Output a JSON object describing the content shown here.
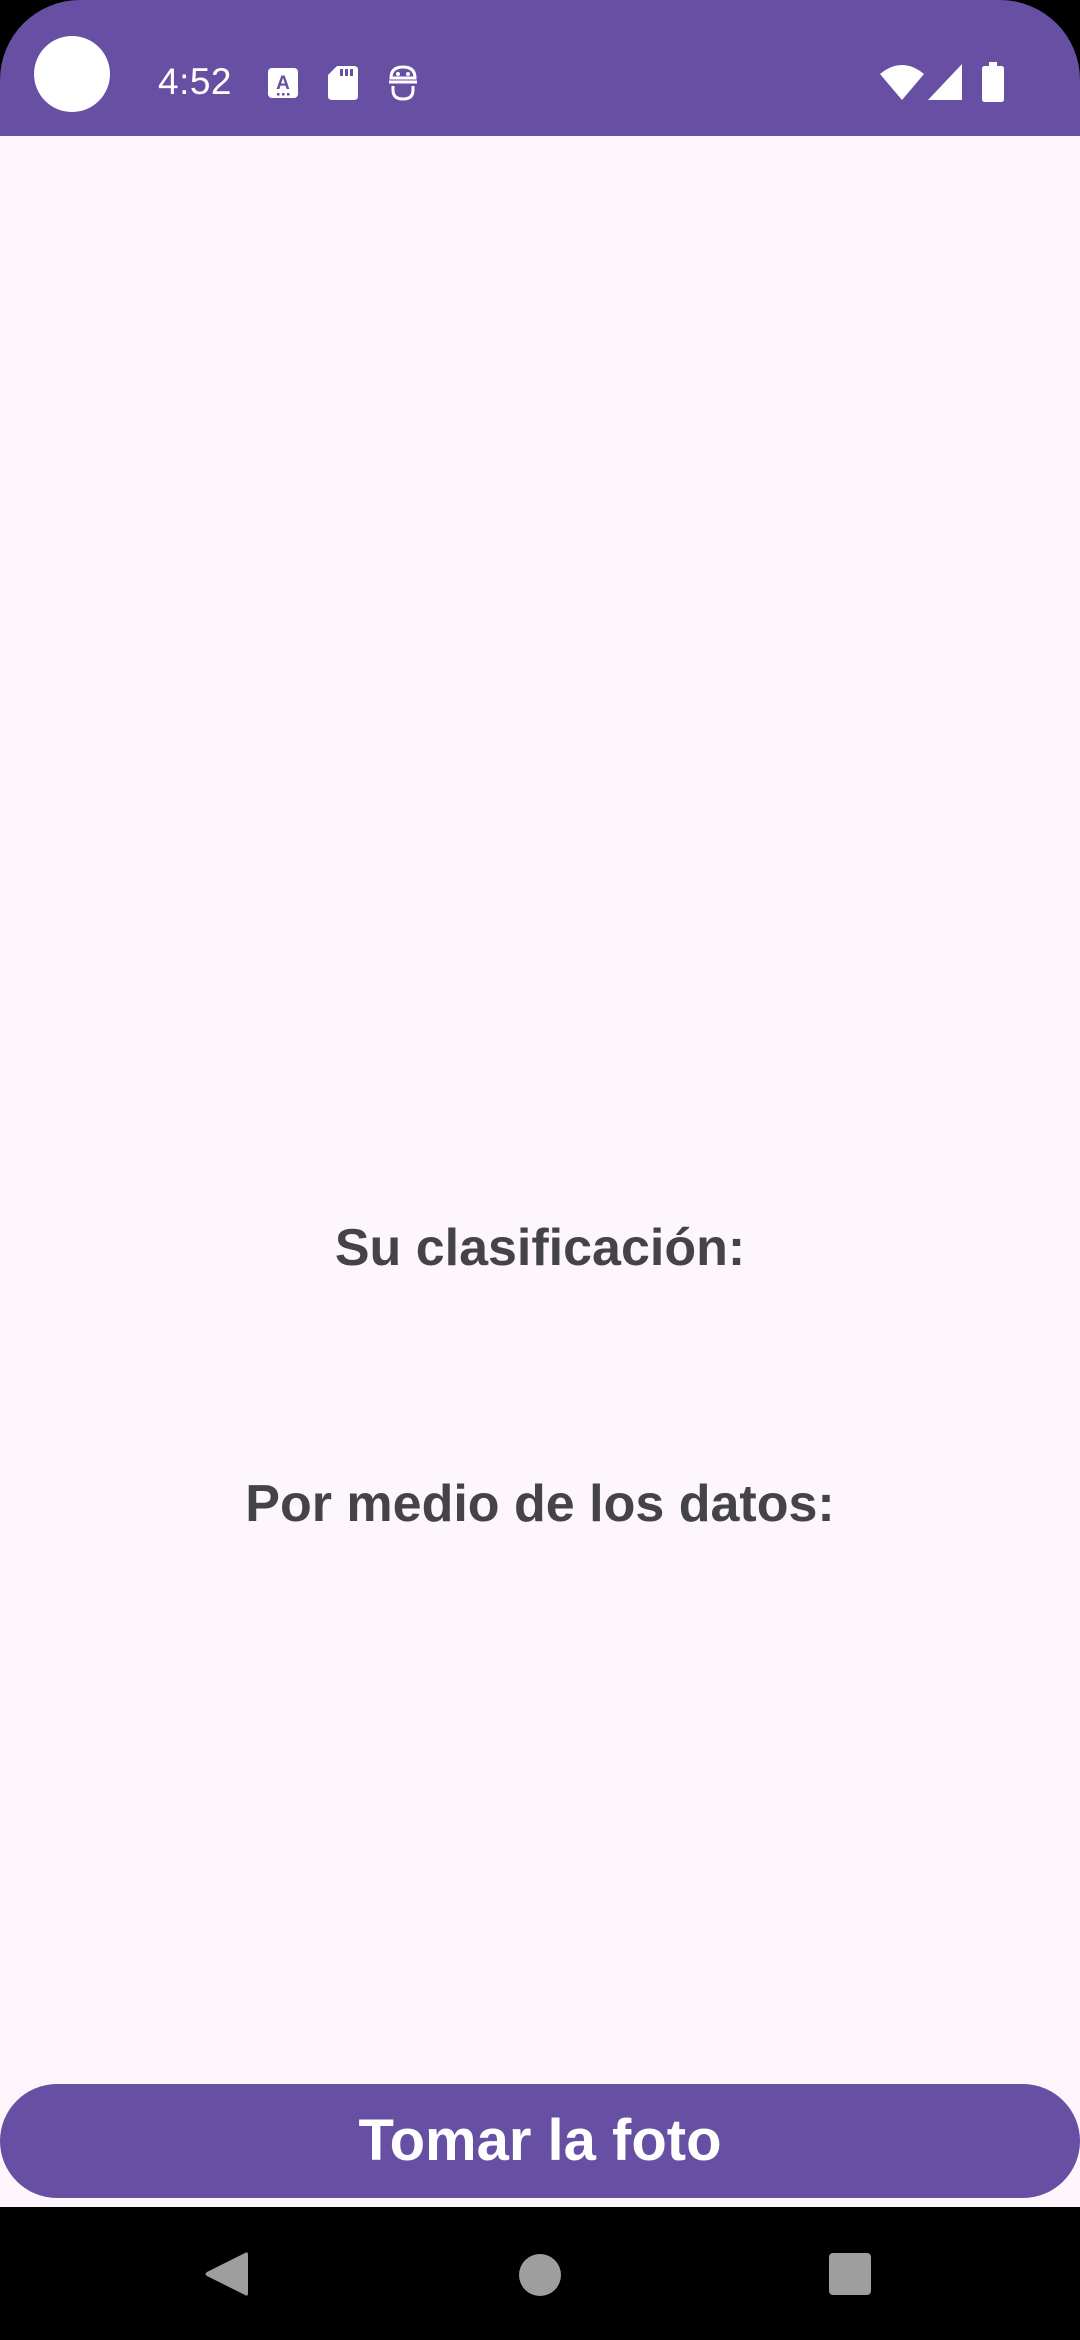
{
  "status_bar": {
    "time": "4:52",
    "left_icons": [
      "font-a-icon",
      "sd-card-icon",
      "android-debug-icon"
    ],
    "right_icons": [
      "wifi-icon",
      "cell-signal-icon",
      "battery-icon"
    ],
    "background_color": "#6750a4"
  },
  "main": {
    "classification_label": "Su clasificación:",
    "data_label": "Por medio de los datos:",
    "take_photo_button": "Tomar la foto",
    "background_color": "#fdf6fd",
    "accent_color": "#6750a4"
  },
  "nav_bar": {
    "buttons": [
      "back-icon",
      "home-icon",
      "recents-icon"
    ]
  }
}
